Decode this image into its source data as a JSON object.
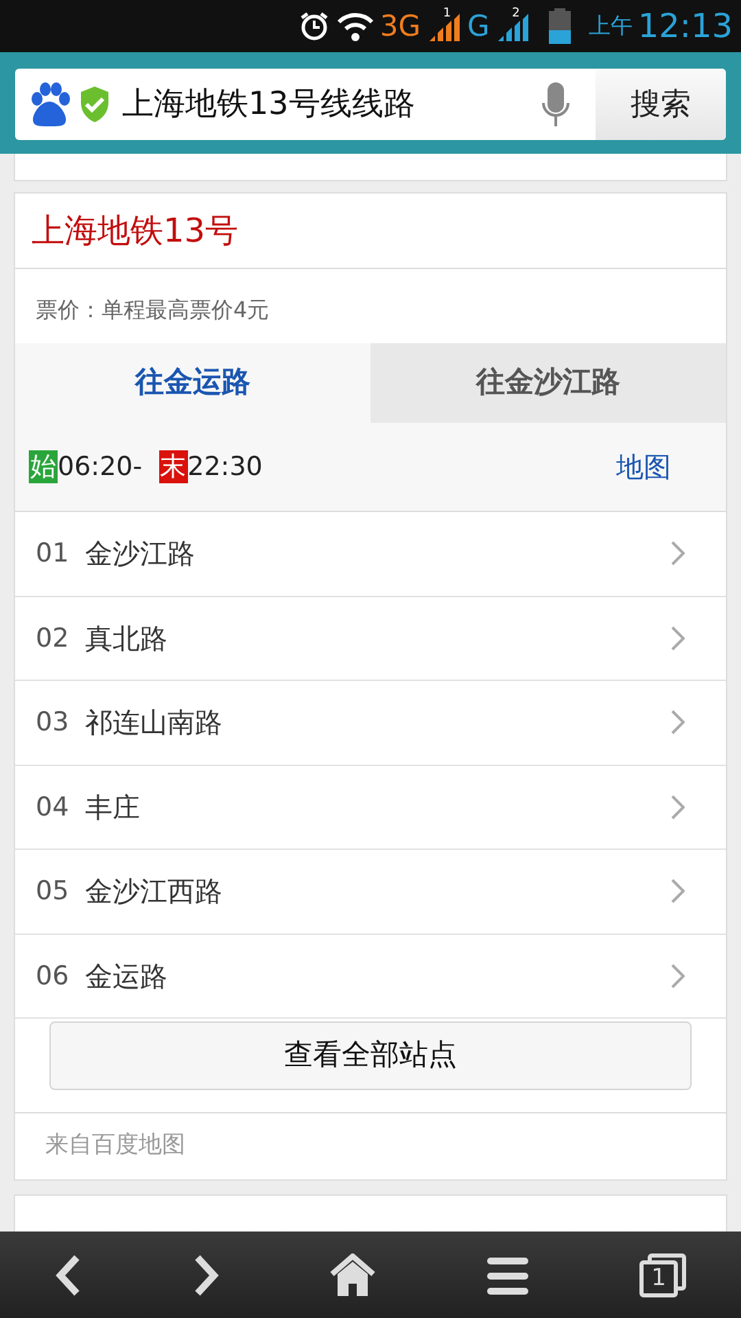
{
  "status_bar": {
    "network_1": "3G",
    "sim_1": "1",
    "network_2": "G",
    "sim_2": "2",
    "am_pm": "上午",
    "time": "12:13"
  },
  "search": {
    "value": "上海地铁13号线线路",
    "button": "搜索"
  },
  "card": {
    "title": "上海地铁13号",
    "fare": "票价：单程最高票价4元",
    "tabs": [
      {
        "label": "往金运路",
        "selected": true
      },
      {
        "label": "往金沙江路",
        "selected": false
      }
    ],
    "start_badge": "始",
    "start_time": "06:20-",
    "end_badge": "末",
    "end_time": "22:30",
    "map_link": "地图",
    "stations": [
      {
        "number": "01",
        "name": "金沙江路"
      },
      {
        "number": "02",
        "name": "真北路"
      },
      {
        "number": "03",
        "name": "祁连山南路"
      },
      {
        "number": "04",
        "name": "丰庄"
      },
      {
        "number": "05",
        "name": "金沙江西路"
      },
      {
        "number": "06",
        "name": "金运路"
      }
    ],
    "more_button": "查看全部站点",
    "source": "来自百度地图"
  },
  "toolbar": {
    "tab_count": "1"
  }
}
